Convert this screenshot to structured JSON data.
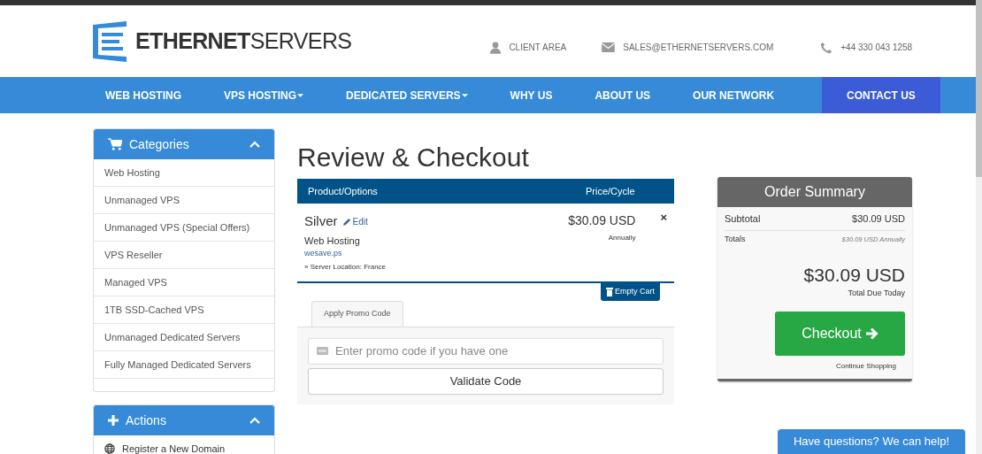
{
  "header": {
    "logo": "**ETHERNET**SERVERS",
    "contacts": [
      {
        "kind": "user",
        "text": "CLIENT AREA"
      },
      {
        "kind": "mail",
        "text": "SALES@ETHERNETSERVERS.COM"
      },
      {
        "kind": "phone",
        "text": "+44 330 043 1258"
      }
    ]
  },
  "nav": [
    {
      "label": "WEB HOSTING",
      "kind": "link",
      "dropdown": false
    },
    {
      "label": "VPS HOSTING",
      "kind": "link",
      "dropdown": true
    },
    {
      "label": "DEDICATED SERVERS",
      "kind": "link",
      "dropdown": true
    },
    {
      "label": "WHY US",
      "kind": "link",
      "dropdown": false
    },
    {
      "label": "ABOUT US",
      "kind": "link",
      "dropdown": false
    },
    {
      "label": "OUR NETWORK",
      "kind": "link",
      "dropdown": false
    },
    {
      "label": "CONTACT US",
      "kind": "cta",
      "dropdown": false
    }
  ],
  "sidebar": [
    {
      "title": "Categories",
      "expanded": true,
      "items": [
        {
          "label": "Web Hosting"
        },
        {
          "label": "Unmanaged VPS"
        },
        {
          "label": "Unmanaged VPS (Special Offers)"
        },
        {
          "label": "VPS Reseller"
        },
        {
          "label": "Managed VPS"
        },
        {
          "label": "1TB SSD-Cached VPS"
        },
        {
          "label": "Unmanaged Dedicated Servers"
        },
        {
          "label": "Fully Managed Dedicated Servers"
        }
      ]
    },
    {
      "title": "Actions",
      "expanded": true,
      "items": [
        {
          "label": "Register a New Domain"
        }
      ]
    }
  ],
  "page_title": "Review & Checkout",
  "cart": {
    "columns": [
      "Product/Options",
      "Price/Cycle"
    ],
    "items": [
      {
        "name": "Silver",
        "edit": "Edit",
        "group": "Web Hosting",
        "domain": "wesave.ps",
        "option": "» Server Location: France",
        "price": "$30.09 USD",
        "cycle": "Annually",
        "remove": "×"
      }
    ],
    "empty_cart": "Empty Cart"
  },
  "promo": {
    "tab": "Apply Promo Code",
    "placeholder": "Enter promo code if you have one",
    "button": "Validate Code"
  },
  "summary": {
    "title": "Order Summary",
    "subtotal_label": "Subtotal",
    "subtotal": "$30.09 USD",
    "totals_label": "Totals",
    "totals": "$30.09 USD Annually",
    "total": "$30.09 USD",
    "total_label": "Total Due Today",
    "checkout": "Checkout",
    "continue": "Continue Shopping"
  },
  "chat": "Have questions? We can help!"
}
